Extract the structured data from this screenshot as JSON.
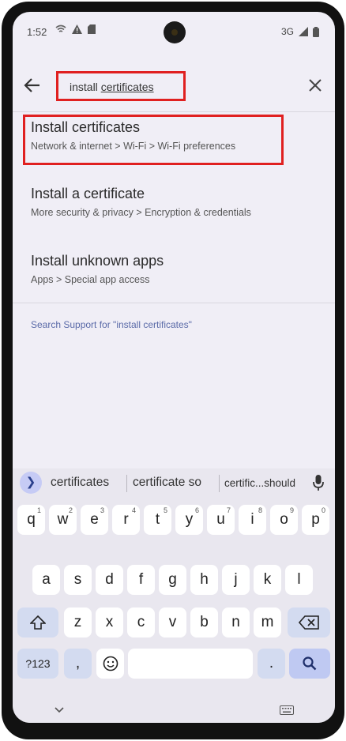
{
  "status_bar": {
    "time": "1:52",
    "network": "3G"
  },
  "search": {
    "query_plain": "install ",
    "query_underlined": "certificates"
  },
  "results": [
    {
      "title": "Install certificates",
      "path": "Network & internet > Wi-Fi > Wi-Fi preferences"
    },
    {
      "title": "Install a certificate",
      "path": "More security & privacy > Encryption & credentials"
    },
    {
      "title": "Install unknown apps",
      "path": "Apps > Special app access"
    }
  ],
  "support_link": "Search Support for \"install certificates\"",
  "suggestions": [
    "certificates",
    "certificate so",
    "certific...should"
  ],
  "keyboard": {
    "row1": [
      {
        "key": "q",
        "hint": "1"
      },
      {
        "key": "w",
        "hint": "2"
      },
      {
        "key": "e",
        "hint": "3"
      },
      {
        "key": "r",
        "hint": "4"
      },
      {
        "key": "t",
        "hint": "5"
      },
      {
        "key": "y",
        "hint": "6"
      },
      {
        "key": "u",
        "hint": "7"
      },
      {
        "key": "i",
        "hint": "8"
      },
      {
        "key": "o",
        "hint": "9"
      },
      {
        "key": "p",
        "hint": "0"
      }
    ],
    "row2": [
      "a",
      "s",
      "d",
      "f",
      "g",
      "h",
      "j",
      "k",
      "l"
    ],
    "row3": [
      "z",
      "x",
      "c",
      "v",
      "b",
      "n",
      "m"
    ],
    "symbols": "?123",
    "comma": ",",
    "period": "."
  },
  "colors": {
    "highlight": "#e02020",
    "accent": "#bfc9f2"
  }
}
